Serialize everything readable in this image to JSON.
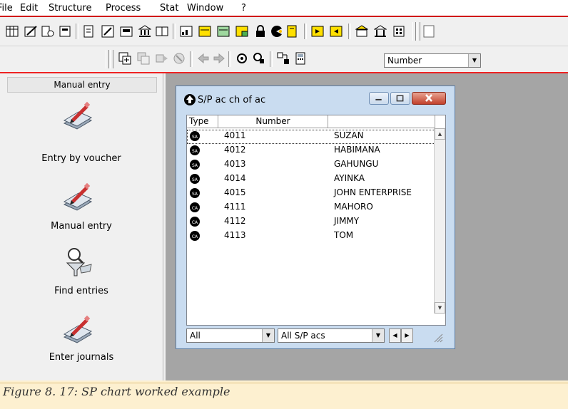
{
  "menu": [
    "File",
    "Edit",
    "Structure",
    "Process",
    "Stat",
    "Window",
    "?"
  ],
  "toolbar": {
    "zoom_select": "Number"
  },
  "left_panel": {
    "header": "Manual entry",
    "items": [
      {
        "label": "Entry by voucher",
        "icon": "pencil-book-icon"
      },
      {
        "label": "Manual entry",
        "icon": "pencil-book-icon"
      },
      {
        "label": "Find entries",
        "icon": "magnifier-funnel-icon"
      },
      {
        "label": "Enter journals",
        "icon": "pencil-book-icon"
      }
    ]
  },
  "window": {
    "title": "S/P ac ch of ac",
    "columns": [
      "Type",
      "Number",
      ""
    ],
    "rows": [
      {
        "type": "SA",
        "number": "4011",
        "name": "SUZAN"
      },
      {
        "type": "SA",
        "number": "4012",
        "name": "HABIMANA"
      },
      {
        "type": "SA",
        "number": "4013",
        "name": "GAHUNGU"
      },
      {
        "type": "SA",
        "number": "4014",
        "name": "AYINKA"
      },
      {
        "type": "SA",
        "number": "4015",
        "name": "JOHN ENTERPRISE"
      },
      {
        "type": "CA",
        "number": "4111",
        "name": "MAHORO"
      },
      {
        "type": "CA",
        "number": "4112",
        "name": "JIMMY"
      },
      {
        "type": "CA",
        "number": "4113",
        "name": "TOM"
      }
    ],
    "filter_left": "All",
    "filter_right": "All S/P acs"
  },
  "caption": "Figure 8. 17: SP chart worked example",
  "colors": {
    "accent_red": "#d00000",
    "workspace": "#a5a5a5",
    "window_frame": "#c9dcf0"
  }
}
